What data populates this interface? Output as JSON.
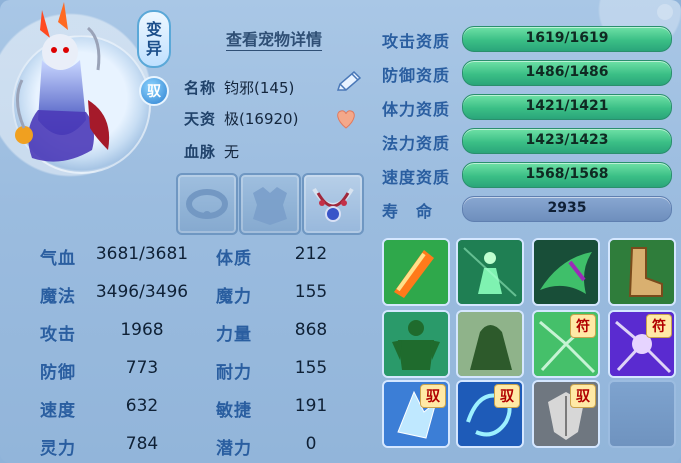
{
  "pet": {
    "mutant_badge_line1": "变",
    "mutant_badge_line2": "异",
    "yu_badge": "驭",
    "detail_link": "查看宠物详情",
    "name_label": "名称",
    "name_value": "钧邪(145)",
    "aptitude_label": "天资",
    "aptitude_value": "极(16920)",
    "bloodline_label": "血脉",
    "bloodline_value": "无"
  },
  "stats": {
    "left": [
      {
        "label": "气血",
        "value": "3681/3681"
      },
      {
        "label": "魔法",
        "value": "3496/3496"
      },
      {
        "label": "攻击",
        "value": "1968"
      },
      {
        "label": "防御",
        "value": "773"
      },
      {
        "label": "速度",
        "value": "632"
      },
      {
        "label": "灵力",
        "value": "784"
      }
    ],
    "right": [
      {
        "label": "体质",
        "value": "212"
      },
      {
        "label": "魔力",
        "value": "155"
      },
      {
        "label": "力量",
        "value": "868"
      },
      {
        "label": "耐力",
        "value": "155"
      },
      {
        "label": "敏捷",
        "value": "191"
      },
      {
        "label": "潜力",
        "value": "0"
      }
    ]
  },
  "qualities": [
    {
      "label": "攻击资质",
      "value": "1619/1619",
      "progress": 1.0
    },
    {
      "label": "防御资质",
      "value": "1486/1486",
      "progress": 1.0
    },
    {
      "label": "体力资质",
      "value": "1421/1421",
      "progress": 1.0
    },
    {
      "label": "法力资质",
      "value": "1423/1423",
      "progress": 1.0
    },
    {
      "label": "速度资质",
      "value": "1568/1568",
      "progress": 1.0
    },
    {
      "label": "寿　命",
      "value": "2935"
    }
  ],
  "skills": [
    {
      "icon": "sword-fire-skill-icon",
      "tag": ""
    },
    {
      "icon": "green-figure-aura-skill-icon",
      "tag": ""
    },
    {
      "icon": "green-claw-skill-icon",
      "tag": ""
    },
    {
      "icon": "boot-skill-icon",
      "tag": ""
    },
    {
      "icon": "green-giant-skill-icon",
      "tag": ""
    },
    {
      "icon": "green-beast-skill-icon",
      "tag": ""
    },
    {
      "icon": "green-burst-skill-icon",
      "tag": "符"
    },
    {
      "icon": "purple-burst-skill-icon",
      "tag": "符"
    },
    {
      "icon": "ice-crystal-skill-icon",
      "tag": "驭"
    },
    {
      "icon": "blue-vortex-skill-icon",
      "tag": "驭"
    },
    {
      "icon": "gray-shield-skill-icon",
      "tag": "驭"
    },
    {
      "icon": "empty-slot",
      "tag": ""
    }
  ],
  "colors": {
    "bar_green": "#3bbf86",
    "label_blue": "#2a5ea0",
    "background": "#9bbcdf"
  }
}
